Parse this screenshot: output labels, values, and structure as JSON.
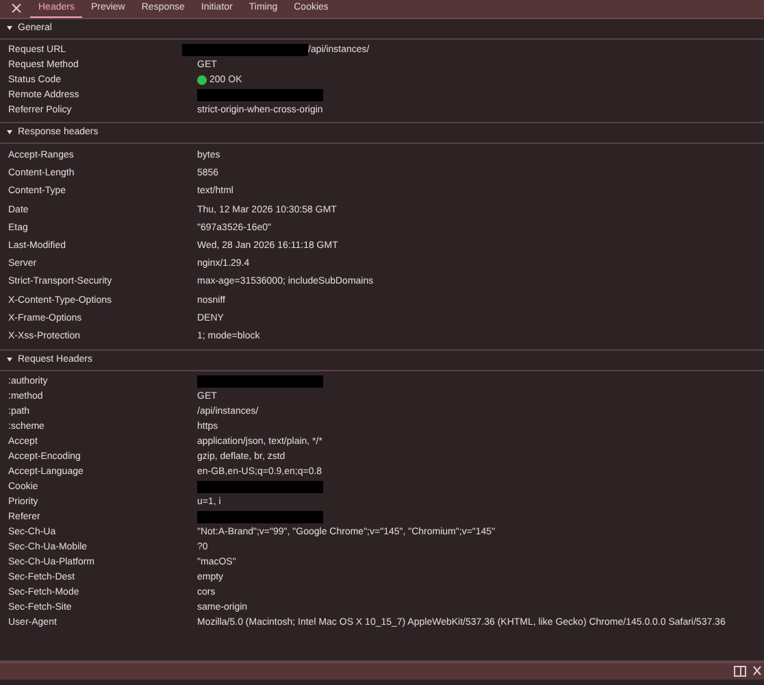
{
  "tabs": [
    {
      "label": "Headers",
      "selected": true
    },
    {
      "label": "Preview",
      "selected": false
    },
    {
      "label": "Response",
      "selected": false
    },
    {
      "label": "Initiator",
      "selected": false
    },
    {
      "label": "Timing",
      "selected": false
    },
    {
      "label": "Cookies",
      "selected": false
    }
  ],
  "sections": [
    {
      "title": "General",
      "expanded": true,
      "rows": [
        {
          "name": "Request URL",
          "kind": "partly_redacted",
          "value": "/api/instances/"
        },
        {
          "name": "Request Method",
          "kind": "text",
          "value": "GET"
        },
        {
          "name": "Status Code",
          "kind": "status",
          "value": "200 OK",
          "color": "#2fbf4f"
        },
        {
          "name": "Remote Address",
          "kind": "redacted"
        },
        {
          "name": "Referrer Policy",
          "kind": "text",
          "value": "strict-origin-when-cross-origin"
        }
      ]
    },
    {
      "title": "Response headers",
      "expanded": true,
      "rows": [
        {
          "name": "Accept-Ranges",
          "kind": "text",
          "value": "bytes"
        },
        {
          "name": "Content-Length",
          "kind": "text",
          "value": "5856"
        },
        {
          "name": "Content-Type",
          "kind": "text",
          "value": "text/html"
        },
        {
          "name": "Date",
          "kind": "text",
          "value": "Thu, 12 Mar 2026 10:30:58 GMT"
        },
        {
          "name": "Etag",
          "kind": "text",
          "value": "\"697a3526-16e0\""
        },
        {
          "name": "Last-Modified",
          "kind": "text",
          "value": "Wed, 28 Jan 2026 16:11:18 GMT"
        },
        {
          "name": "Server",
          "kind": "text",
          "value": "nginx/1.29.4"
        },
        {
          "name": "Strict-Transport-Security",
          "kind": "text",
          "value": "max-age=31536000; includeSubDomains"
        },
        {
          "name": "X-Content-Type-Options",
          "kind": "text",
          "value": "nosniff"
        },
        {
          "name": "X-Frame-Options",
          "kind": "text",
          "value": "DENY"
        },
        {
          "name": "X-Xss-Protection",
          "kind": "text",
          "value": "1; mode=block"
        }
      ]
    },
    {
      "title": "Request Headers",
      "expanded": true,
      "rows": [
        {
          "name": ":authority",
          "kind": "redacted"
        },
        {
          "name": ":method",
          "kind": "text",
          "value": "GET"
        },
        {
          "name": ":path",
          "kind": "text",
          "value": "/api/instances/"
        },
        {
          "name": ":scheme",
          "kind": "text",
          "value": "https"
        },
        {
          "name": "Accept",
          "kind": "text",
          "value": "application/json, text/plain, */*"
        },
        {
          "name": "Accept-Encoding",
          "kind": "text",
          "value": "gzip, deflate, br, zstd"
        },
        {
          "name": "Accept-Language",
          "kind": "text",
          "value": "en-GB,en-US;q=0.9,en;q=0.8"
        },
        {
          "name": "Cookie",
          "kind": "redacted"
        },
        {
          "name": "Priority",
          "kind": "text",
          "value": "u=1, i"
        },
        {
          "name": "Referer",
          "kind": "redacted"
        },
        {
          "name": "Sec-Ch-Ua",
          "kind": "text",
          "value": "\"Not:A-Brand\";v=\"99\", \"Google Chrome\";v=\"145\", \"Chromium\";v=\"145\""
        },
        {
          "name": "Sec-Ch-Ua-Mobile",
          "kind": "text",
          "value": "?0"
        },
        {
          "name": "Sec-Ch-Ua-Platform",
          "kind": "text",
          "value": "\"macOS\""
        },
        {
          "name": "Sec-Fetch-Dest",
          "kind": "text",
          "value": "empty"
        },
        {
          "name": "Sec-Fetch-Mode",
          "kind": "text",
          "value": "cors"
        },
        {
          "name": "Sec-Fetch-Site",
          "kind": "text",
          "value": "same-origin"
        },
        {
          "name": "User-Agent",
          "kind": "text",
          "value": "Mozilla/5.0 (Macintosh; Intel Mac OS X 10_15_7) AppleWebKit/537.36 (KHTML, like Gecko) Chrome/145.0.0.0 Safari/537.36"
        }
      ]
    }
  ]
}
